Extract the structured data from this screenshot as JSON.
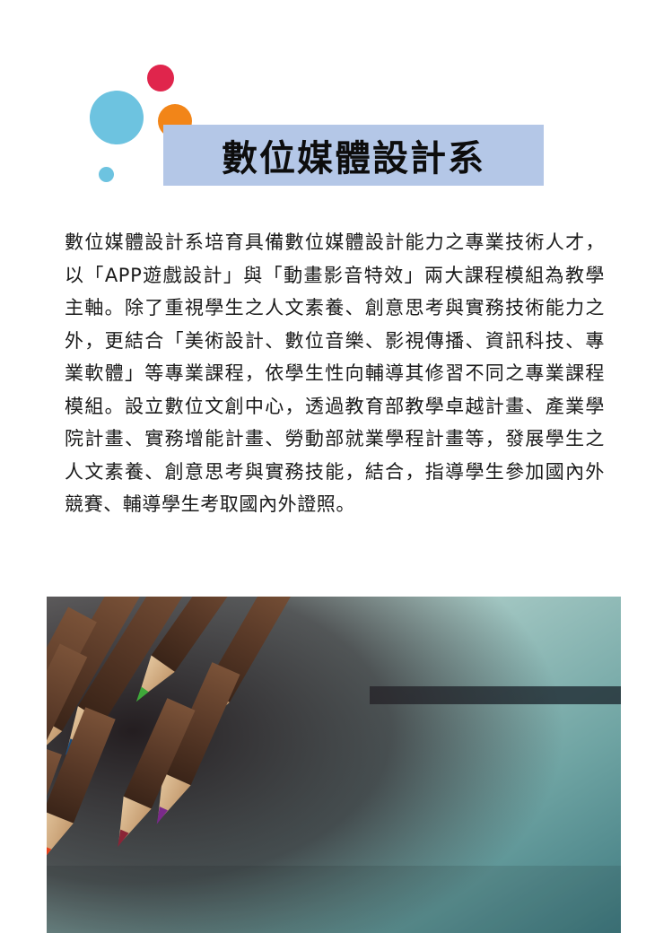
{
  "colors": {
    "dot_red": "#e0254c",
    "dot_blue": "#6dc3e0",
    "dot_orange": "#f28518",
    "dot_small": "#6dc3e0",
    "title_background": "#b4c7e7"
  },
  "title": "數位媒體設計系",
  "description": "數位媒體設計系培育具備數位媒體設計能力之專業技術人才，以「APP遊戲設計」與「動畫影音特效」兩大課程模組為教學主軸。除了重視學生之人文素養、創意思考與實務技術能力之外，更結合「美術設計、數位音樂、影視傳播、資訊科技、專業軟體」等專業課程，依學生性向輔導其修習不同之專業課程模組。設立數位文創中心，透過教育部教學卓越計畫、產業學院計畫、實務增能計畫、勞動部就業學程計畫等，發展學生之人文素養、創意思考與實務技能，結合，指導學生參加國內外競賽、輔導學生考取國內外證照。",
  "photo": {
    "subject": "colored-pencils-photo",
    "pencil_tip_colors": [
      "#3fa83a",
      "#2a7a6a",
      "#1e4d7a",
      "#8a2436",
      "#d11f1f",
      "#7a2a8a",
      "#c0202a",
      "#e8401a",
      "#2f6fb0",
      "#6b1f2a"
    ]
  }
}
